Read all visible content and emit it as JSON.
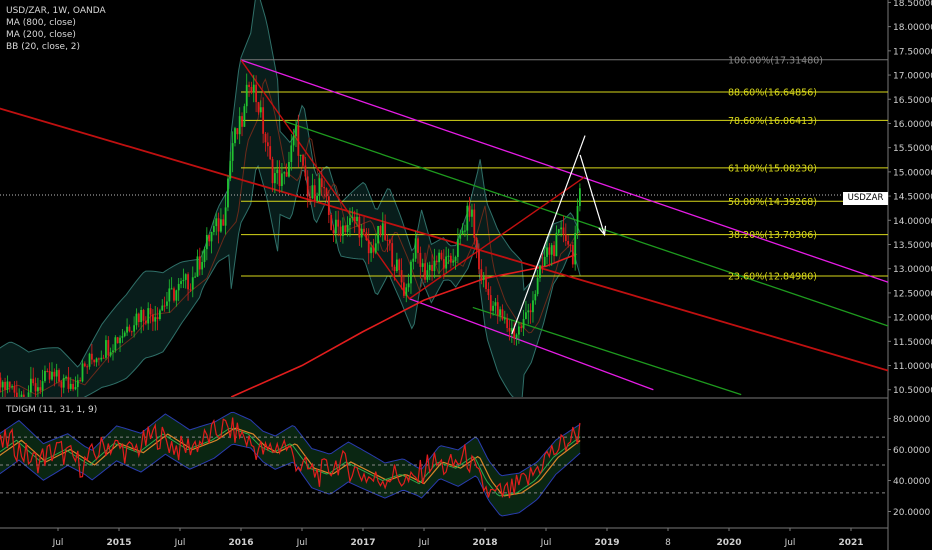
{
  "legend": {
    "symbol": "USD/ZAR, 1W, OANDA",
    "ma800": "MA (800, close)",
    "ma200": "MA (200, close)",
    "bb": "BB (20, close, 2)",
    "indicator": "TDIGM (11, 31, 1, 9)"
  },
  "price_tag": {
    "symbol": "USDZAR",
    "value": "14.52180"
  },
  "colors": {
    "background": "#000000",
    "up_candle": "#21c531",
    "down_candle": "#e01c1c",
    "pitchfork": "#e61ce6",
    "median_line": "#c01010",
    "green_channel": "#1e9a1e",
    "fibonacci": "#d8d81a",
    "ma200": "#e11d1d",
    "arrows": "#ffffff"
  },
  "chart_data": [
    {
      "type": "candlestick",
      "title": "USD/ZAR, 1W, OANDA",
      "y_axis": {
        "position": "right",
        "ticks": [
          "18.50000",
          "18.00000",
          "17.50000",
          "17.00000",
          "16.50000",
          "16.00000",
          "15.50000",
          "15.00000",
          "14.50000",
          "14.00000",
          "13.50000",
          "13.00000",
          "12.50000",
          "12.00000",
          "11.50000",
          "11.00000",
          "10.50000"
        ],
        "range": [
          10.35,
          18.55
        ]
      },
      "x_axis": {
        "ticks": [
          "Jul",
          "2015",
          "Jul",
          "2016",
          "Jul",
          "2017",
          "Jul",
          "2018",
          "Jul",
          "2019",
          "8",
          "2020",
          "Jul",
          "2021"
        ]
      },
      "last_price": 14.5218,
      "fibonacci": [
        {
          "label": "100.00%(17.31480)",
          "value": 17.3148
        },
        {
          "label": "88.60%(16.64856)",
          "value": 16.64856
        },
        {
          "label": "78.60%(16.06413)",
          "value": 16.06413
        },
        {
          "label": "61.80%(15.08230)",
          "value": 15.0823
        },
        {
          "label": "50.00%(14.39268)",
          "value": 14.39268
        },
        {
          "label": "38.20%(13.70306)",
          "value": 13.70306
        },
        {
          "label": "23.60%(12.84980)",
          "value": 12.8498
        }
      ],
      "trend_lines": [
        {
          "name": "pitchfork-upper",
          "from": [
            2016.0,
            17.31
          ],
          "to": [
            2021.5,
            12.55
          ]
        },
        {
          "name": "pitchfork-lower",
          "from": [
            2017.38,
            12.38
          ],
          "to": [
            2019.38,
            10.5
          ]
        },
        {
          "name": "median",
          "from": [
            2013.7,
            16.55
          ],
          "to": [
            2021.5,
            10.75
          ]
        },
        {
          "name": "green-upper",
          "from": [
            2016.35,
            16.05
          ],
          "to": [
            2021.5,
            11.65
          ]
        },
        {
          "name": "green-lower",
          "from": [
            2017.9,
            12.2
          ],
          "to": [
            2020.1,
            10.4
          ]
        }
      ],
      "price_path": [
        [
          2013.72,
          10.9
        ],
        [
          2013.9,
          10.45
        ],
        [
          2014.05,
          10.6
        ],
        [
          2014.2,
          10.4
        ],
        [
          2014.45,
          10.75
        ],
        [
          2014.6,
          10.6
        ],
        [
          2014.8,
          11.2
        ],
        [
          2015.0,
          11.6
        ],
        [
          2015.15,
          12.05
        ],
        [
          2015.3,
          12.1
        ],
        [
          2015.45,
          12.5
        ],
        [
          2015.6,
          12.8
        ],
        [
          2015.75,
          13.7
        ],
        [
          2015.85,
          14.0
        ],
        [
          2015.93,
          15.6
        ],
        [
          2016.02,
          16.1
        ],
        [
          2016.07,
          17.0
        ],
        [
          2016.15,
          16.3
        ],
        [
          2016.25,
          15.0
        ],
        [
          2016.35,
          14.8
        ],
        [
          2016.45,
          15.8
        ],
        [
          2016.55,
          14.4
        ],
        [
          2016.65,
          14.8
        ],
        [
          2016.75,
          13.8
        ],
        [
          2016.85,
          13.9
        ],
        [
          2016.95,
          14.0
        ],
        [
          2017.05,
          13.3
        ],
        [
          2017.15,
          13.8
        ],
        [
          2017.25,
          13.2
        ],
        [
          2017.35,
          12.5
        ],
        [
          2017.42,
          13.5
        ],
        [
          2017.5,
          12.9
        ],
        [
          2017.6,
          13.2
        ],
        [
          2017.7,
          13.05
        ],
        [
          2017.8,
          13.6
        ],
        [
          2017.88,
          14.3
        ],
        [
          2017.95,
          13.0
        ],
        [
          2018.05,
          12.3
        ],
        [
          2018.15,
          11.9
        ],
        [
          2018.25,
          11.65
        ],
        [
          2018.32,
          11.9
        ],
        [
          2018.42,
          12.6
        ],
        [
          2018.5,
          13.3
        ],
        [
          2018.58,
          13.5
        ],
        [
          2018.65,
          13.8
        ],
        [
          2018.72,
          13.3
        ],
        [
          2018.78,
          14.52
        ]
      ],
      "ma200_path": [
        [
          2015.92,
          10.35
        ],
        [
          2016.5,
          11.0
        ],
        [
          2017.0,
          11.7
        ],
        [
          2017.5,
          12.35
        ],
        [
          2018.0,
          12.8
        ],
        [
          2018.5,
          13.05
        ],
        [
          2018.75,
          13.3
        ]
      ],
      "arrows": [
        {
          "from": [
            2018.22,
            11.65
          ],
          "to": [
            2018.82,
            15.75
          ]
        },
        {
          "from": [
            2018.78,
            15.35
          ],
          "to": [
            2018.98,
            13.7
          ]
        }
      ]
    },
    {
      "type": "line",
      "title": "TDIGM (11, 31, 1, 9)",
      "y_axis": {
        "position": "right",
        "ticks": [
          "80.0000",
          "60.0000",
          "40.0000",
          "20.0000"
        ],
        "range": [
          10,
          92
        ]
      },
      "levels": [
        68,
        50,
        32
      ],
      "series": [
        {
          "values_by_year": [
            [
              2013.72,
              62
            ],
            [
              2013.9,
              55
            ],
            [
              2014.1,
              66
            ],
            [
              2014.3,
              52
            ],
            [
              2014.5,
              60
            ],
            [
              2014.7,
              50
            ],
            [
              2014.9,
              64
            ],
            [
              2015.1,
              58
            ],
            [
              2015.3,
              70
            ],
            [
              2015.5,
              60
            ],
            [
              2015.7,
              66
            ],
            [
              2015.85,
              74
            ],
            [
              2016.0,
              70
            ],
            [
              2016.1,
              62
            ],
            [
              2016.2,
              58
            ],
            [
              2016.35,
              64
            ],
            [
              2016.5,
              48
            ],
            [
              2016.65,
              44
            ],
            [
              2016.8,
              52
            ],
            [
              2016.95,
              46
            ],
            [
              2017.1,
              40
            ],
            [
              2017.25,
              44
            ],
            [
              2017.4,
              38
            ],
            [
              2017.55,
              52
            ],
            [
              2017.7,
              48
            ],
            [
              2017.85,
              56
            ],
            [
              2017.95,
              40
            ],
            [
              2018.05,
              30
            ],
            [
              2018.2,
              32
            ],
            [
              2018.35,
              40
            ],
            [
              2018.5,
              55
            ],
            [
              2018.65,
              64
            ],
            [
              2018.78,
              72
            ]
          ]
        }
      ]
    }
  ]
}
